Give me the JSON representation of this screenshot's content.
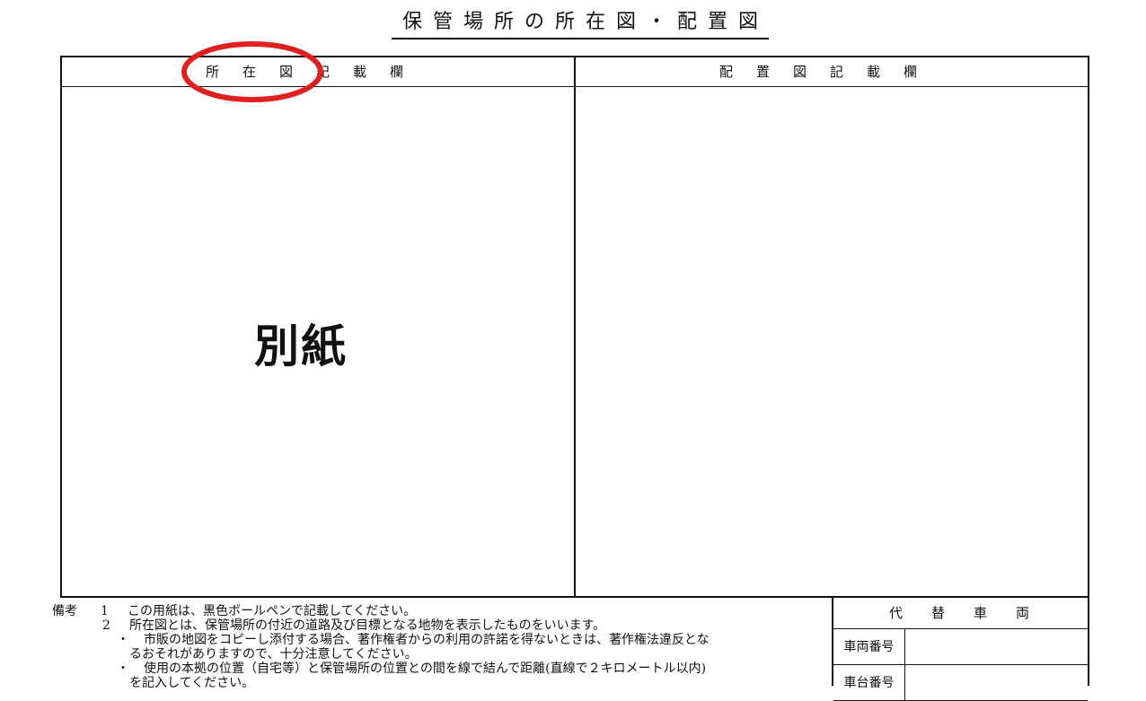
{
  "document": {
    "title": "保管場所の所在図・配置図"
  },
  "left_panel": {
    "header": "所在図記載欄",
    "body_label": "別紙"
  },
  "right_panel": {
    "header": "配置図記載欄"
  },
  "notes": {
    "heading": "備考",
    "lines": [
      {
        "num": "1",
        "text": "この用紙は、黒色ボールペンで記載してください。"
      },
      {
        "num": "2",
        "text": "所在図とは、保管場所の付近の道路及び目標となる地物を表示したものをいいます。"
      },
      {
        "num": "・",
        "text": "市販の地図をコピーし添付する場合、著作権者からの利用の許諾を得ないときは、著作権法違反とな"
      },
      {
        "num": "",
        "text": "るおそれがありますので、十分注意してください。"
      },
      {
        "num": "・",
        "text": "使用の本拠の位置（自宅等）と保管場所の位置との間を線で結んで距離(直線で２キロメートル以内)"
      },
      {
        "num": "",
        "text": "を記入してください。"
      }
    ]
  },
  "substitute_vehicle": {
    "header": "代替車両",
    "rows": [
      {
        "label": "車両番号"
      },
      {
        "label": "車台番号"
      }
    ]
  },
  "annotation": {
    "color": "#e02020"
  }
}
